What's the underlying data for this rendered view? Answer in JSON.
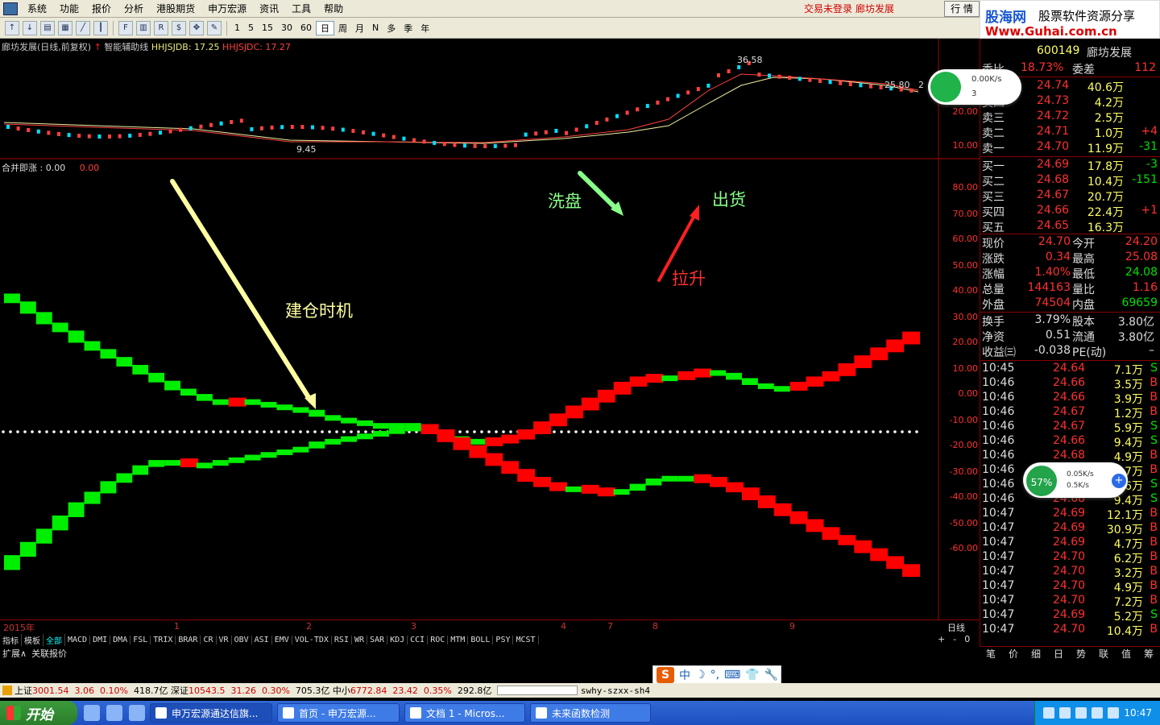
{
  "menubar": {
    "items": [
      "系统",
      "功能",
      "报价",
      "分析",
      "港股期货",
      "申万宏源",
      "资讯",
      "工具",
      "帮助"
    ],
    "notice1": "交易未登录",
    "notice2": "廊坊发展",
    "hq": "行 情"
  },
  "logo": {
    "brand": "股海网",
    "slogan": "股票软件资源分享",
    "url": "Www.Guhai.com.cn"
  },
  "toolbar": {
    "periods": [
      "1",
      "5",
      "15",
      "30",
      "60",
      "日",
      "周",
      "月",
      "N",
      "多",
      "季",
      "年"
    ],
    "active": "日",
    "icons": [
      "up-icon",
      "down-icon",
      "layout-icon",
      "grid-icon",
      "line-icon",
      "candle-icon",
      "f10-icon",
      "bar-icon",
      "rsi-icon",
      "dollar-icon",
      "move-icon",
      "pen-icon"
    ]
  },
  "chart": {
    "info": {
      "stock": "廊坊发展(日线,前复权)",
      "helper": "智能辅助线",
      "hhjsjdb": "HHJSJDB: 17.25",
      "hhjsjdc": "HHJSJDC: 17.27"
    },
    "price_labels": {
      "high": "36.58",
      "low": "9.45",
      "mid": "25.80",
      "tail": "2"
    },
    "price_axis": [
      "20.00",
      "10.00"
    ],
    "indicator": {
      "name": "合并即涨",
      "value": ": 0.00",
      "value2": "0.00"
    },
    "ind_axis": [
      "80.00",
      "70.00",
      "60.00",
      "50.00",
      "40.00",
      "30.00",
      "20.00",
      "10.00",
      "0.00",
      "-10.00",
      "-20.00",
      "-30.00",
      "-40.00",
      "-50.00",
      "-60.00"
    ],
    "annotations": {
      "build": "建仓时机",
      "wash": "洗盘",
      "ship": "出货",
      "lift": "拉升"
    },
    "dates": {
      "year": "2015年",
      "m1": "1",
      "m2": "2",
      "m3": "3",
      "m4": "4",
      "m7": "7",
      "m8": "8",
      "m9": "9",
      "period": "日线"
    }
  },
  "chart_data": {
    "type": "line",
    "title": "合并即涨",
    "x": [
      0,
      1,
      2,
      3,
      4,
      5,
      6,
      7,
      8,
      9,
      10,
      11,
      12,
      13,
      14,
      15,
      16,
      17,
      18,
      19,
      20,
      21,
      22,
      23,
      24,
      25,
      26,
      27,
      28,
      29,
      30,
      31,
      32,
      33,
      34,
      35,
      36,
      37,
      38,
      39,
      40,
      41,
      42,
      43,
      44,
      45,
      46,
      47,
      48,
      49,
      50,
      51,
      52,
      53,
      54,
      55,
      56,
      57
    ],
    "series": [
      {
        "values": [
          52,
          49,
          45,
          41,
          38,
          34,
          31,
          28,
          25,
          22,
          19,
          16,
          14,
          12,
          11,
          12,
          11,
          10,
          9,
          8,
          6,
          5,
          4,
          3,
          3,
          3,
          2,
          0,
          -2,
          -3,
          -4,
          -3,
          -2,
          0,
          3,
          6,
          9,
          12,
          15,
          18,
          20,
          21,
          21,
          22,
          23,
          22,
          20,
          18,
          17,
          17,
          18,
          20,
          22,
          25,
          28,
          31,
          34,
          37
        ]
      },
      {
        "values": [
          -52,
          -47,
          -42,
          -37,
          -32,
          -27,
          -23,
          -19,
          -16,
          -13,
          -11,
          -11,
          -12,
          -12,
          -11,
          -10,
          -9,
          -8,
          -7,
          -6,
          -4,
          -3,
          -2,
          -1,
          0,
          1,
          2,
          0,
          -3,
          -6,
          -9,
          -12,
          -15,
          -18,
          -20,
          -21,
          -21,
          -22,
          -23,
          -22,
          -20,
          -18,
          -17,
          -17,
          -18,
          -20,
          -22,
          -25,
          -28,
          -31,
          -34,
          -37,
          -40,
          -42,
          -45,
          -48,
          -51,
          -54
        ]
      }
    ],
    "ylim": [
      -70,
      90
    ],
    "grid": false
  },
  "right": {
    "header_code": "600149",
    "header_name": "廊坊发展",
    "ratio_label": "委比",
    "ratio": "18.73%",
    "diff_label": "委差",
    "diff": "112",
    "asks": [
      {
        "label": "卖五",
        "price": "24.74",
        "vol": "40.6万",
        "chg": ""
      },
      {
        "label": "卖四",
        "price": "24.73",
        "vol": "4.2万",
        "chg": ""
      },
      {
        "label": "卖三",
        "price": "24.72",
        "vol": "2.5万",
        "chg": ""
      },
      {
        "label": "卖二",
        "price": "24.71",
        "vol": "1.0万",
        "chg": "+4"
      },
      {
        "label": "卖一",
        "price": "24.70",
        "vol": "11.9万",
        "chg": "-31"
      }
    ],
    "bids": [
      {
        "label": "买一",
        "price": "24.69",
        "vol": "17.8万",
        "chg": "-3"
      },
      {
        "label": "买二",
        "price": "24.68",
        "vol": "10.4万",
        "chg": "-151"
      },
      {
        "label": "买三",
        "price": "24.67",
        "vol": "20.7万",
        "chg": ""
      },
      {
        "label": "买四",
        "price": "24.66",
        "vol": "22.4万",
        "chg": "+1"
      },
      {
        "label": "买五",
        "price": "24.65",
        "vol": "16.3万",
        "chg": ""
      }
    ],
    "stats": [
      {
        "l1": "现价",
        "v1": "24.70",
        "l2": "今开",
        "v2": "24.20"
      },
      {
        "l1": "涨跌",
        "v1": "0.34",
        "l2": "最高",
        "v2": "25.08"
      },
      {
        "l1": "涨幅",
        "v1": "1.40%",
        "l2": "最低",
        "v2": "24.08"
      },
      {
        "l1": "总量",
        "v1": "144163",
        "l2": "量比",
        "v2": "1.16"
      },
      {
        "l1": "外盘",
        "v1": "74504",
        "l2": "内盘",
        "v2": "69659"
      }
    ],
    "stats2": [
      {
        "l1": "换手",
        "v1": "3.79%",
        "l2": "股本",
        "v2": "3.80亿"
      },
      {
        "l1": "净资",
        "v1": "0.51",
        "l2": "流通",
        "v2": "3.80亿"
      },
      {
        "l1": "收益㈢",
        "v1": "-0.038",
        "l2": "PE(动)",
        "v2": "–"
      }
    ],
    "ticks": [
      {
        "t": "10:45",
        "p": "24.64",
        "v": "7.1万",
        "s": "S"
      },
      {
        "t": "10:46",
        "p": "24.66",
        "v": "3.5万",
        "s": "B"
      },
      {
        "t": "10:46",
        "p": "24.66",
        "v": "3.9万",
        "s": "B"
      },
      {
        "t": "10:46",
        "p": "24.67",
        "v": "1.2万",
        "s": "B"
      },
      {
        "t": "10:46",
        "p": "24.67",
        "v": "5.9万",
        "s": "S"
      },
      {
        "t": "10:46",
        "p": "24.66",
        "v": "9.4万",
        "s": "S"
      },
      {
        "t": "10:46",
        "p": "24.68",
        "v": "4.9万",
        "s": "B"
      },
      {
        "t": "10:46",
        "p": "24.68",
        "v": "3.7万",
        "s": "B"
      },
      {
        "t": "10:46",
        "p": "24.67",
        "v": "5.6万",
        "s": "S"
      },
      {
        "t": "10:46",
        "p": "24.68",
        "v": "9.4万",
        "s": "S"
      },
      {
        "t": "10:47",
        "p": "24.69",
        "v": "12.1万",
        "s": "B"
      },
      {
        "t": "10:47",
        "p": "24.69",
        "v": "30.9万",
        "s": "B"
      },
      {
        "t": "10:47",
        "p": "24.69",
        "v": "4.7万",
        "s": "B"
      },
      {
        "t": "10:47",
        "p": "24.70",
        "v": "6.2万",
        "s": "B"
      },
      {
        "t": "10:47",
        "p": "24.70",
        "v": "3.2万",
        "s": "B"
      },
      {
        "t": "10:47",
        "p": "24.70",
        "v": "4.9万",
        "s": "B"
      },
      {
        "t": "10:47",
        "p": "24.70",
        "v": "7.2万",
        "s": "B"
      },
      {
        "t": "10:47",
        "p": "24.69",
        "v": "5.2万",
        "s": "S"
      },
      {
        "t": "10:47",
        "p": "24.70",
        "v": "10.4万",
        "s": "B"
      }
    ],
    "tabs": [
      "笔",
      "价",
      "细",
      "日",
      "势",
      "联",
      "值",
      "筹"
    ]
  },
  "bottom_tabs": [
    "指标",
    "模板",
    "全部",
    "MACD",
    "DMI",
    "DMA",
    "FSL",
    "TRIX",
    "BRAR",
    "CR",
    "VR",
    "OBV",
    "ASI",
    "EMV",
    "VOL-TDX",
    "RSI",
    "WR",
    "SAR",
    "KDJ",
    "CCI",
    "ROC",
    "MTM",
    "BOLL",
    "PSY",
    "MCST"
  ],
  "ext": [
    "扩展∧",
    "关联报价"
  ],
  "tab_controls": [
    "+",
    "-",
    "0"
  ],
  "netwidget": {
    "speed": "0.00K/s",
    "count": "3"
  },
  "netwidget2": {
    "pct": "57%",
    "up": "0.05K/s",
    "down": "0.5K/s"
  },
  "ime": {
    "label": "中"
  },
  "status": {
    "sh_label": "上证",
    "sh": "3001.54",
    "sh_chg": "3.06",
    "sh_pct": "0.10%",
    "sh_amt": "418.7亿",
    "sz_label": "深证",
    "sz": "10543.5",
    "sz_chg": "31.26",
    "sz_pct": "0.30%",
    "sz_amt": "705.3亿",
    "zx_label": "中小",
    "zx": "6772.84",
    "zx_chg": "23.42",
    "zx_pct": "0.35%",
    "zx_amt": "292.8亿",
    "server": "swhy-szxx-sh4"
  },
  "taskbar": {
    "start": "开始",
    "tasks": [
      "申万宏源通达信旗...",
      "首页 - 申万宏源...",
      "文档 1 - Micros...",
      "未来函数检测"
    ],
    "clock": "10:47"
  }
}
